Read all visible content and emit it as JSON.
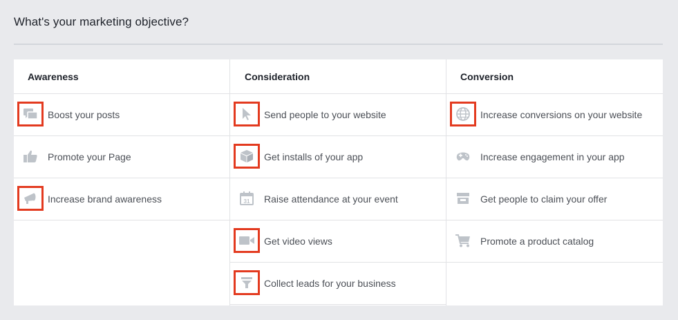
{
  "page": {
    "title": "What's your marketing objective?"
  },
  "colors": {
    "icon": "#bec3c9",
    "highlight": "#e33a1f",
    "text": "#4b4f56",
    "background": "#e9eaed"
  },
  "columns": [
    {
      "header": "Awareness",
      "items": [
        {
          "label": "Boost your posts",
          "icon": "speech-bubbles-icon",
          "highlighted": true
        },
        {
          "label": "Promote your Page",
          "icon": "thumbs-up-icon",
          "highlighted": false
        },
        {
          "label": "Increase brand awareness",
          "icon": "megaphone-icon",
          "highlighted": true
        }
      ]
    },
    {
      "header": "Consideration",
      "items": [
        {
          "label": "Send people to your website",
          "icon": "cursor-icon",
          "highlighted": true
        },
        {
          "label": "Get installs of your app",
          "icon": "box-icon",
          "highlighted": true
        },
        {
          "label": "Raise attendance at your event",
          "icon": "calendar-icon",
          "calendar_text": "31",
          "highlighted": false
        },
        {
          "label": "Get video views",
          "icon": "video-camera-icon",
          "highlighted": true
        },
        {
          "label": "Collect leads for your business",
          "icon": "funnel-icon",
          "highlighted": true
        }
      ]
    },
    {
      "header": "Conversion",
      "items": [
        {
          "label": "Increase conversions on your website",
          "icon": "globe-icon",
          "highlighted": true
        },
        {
          "label": "Increase engagement in your app",
          "icon": "gamepad-icon",
          "highlighted": false
        },
        {
          "label": "Get people to claim your offer",
          "icon": "storefront-icon",
          "highlighted": false
        },
        {
          "label": "Promote a product catalog",
          "icon": "shopping-cart-icon",
          "highlighted": false
        }
      ]
    }
  ]
}
